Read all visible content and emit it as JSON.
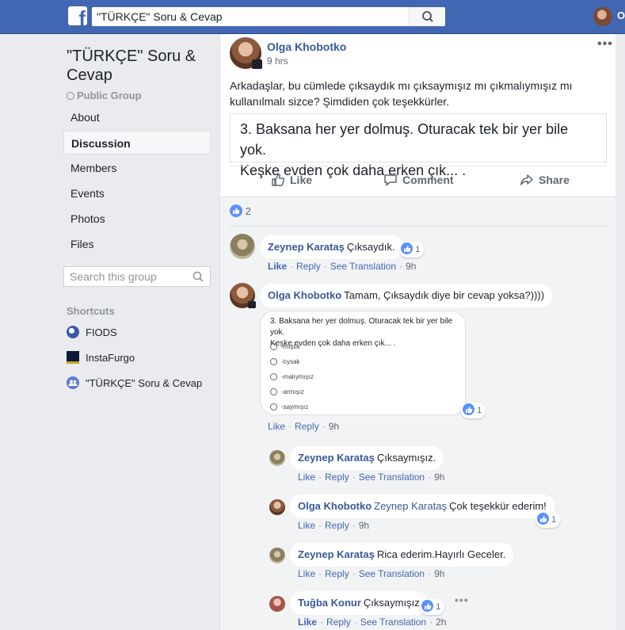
{
  "topbar": {
    "logo": "f",
    "search_value": "\"TÜRKÇE\" Soru & Cevap",
    "user_initial": "O"
  },
  "sidebar": {
    "group_title": "\"TÜRKÇE\" Soru & Cevap",
    "group_type": "Public Group",
    "nav": [
      "About",
      "Discussion",
      "Members",
      "Events",
      "Photos",
      "Files"
    ],
    "active_nav": "Discussion",
    "search_placeholder": "Search this group",
    "shortcuts_heading": "Shortcuts",
    "shortcuts": [
      "FIODS",
      "InstaFurgo",
      "\"TÜRKÇE\" Soru & Cevap"
    ]
  },
  "post": {
    "author": "Olga Khobotko",
    "time": "9 hrs",
    "more": "•••",
    "text": "Arkadaşlar, bu cümlede çıksaydık mı çıksaymışız mı çıkmalıymışız mı kullanılmalı sizce? Şimdiden çok teşekkürler.",
    "image_text_line1": "3. Baksana her yer dolmuş. Oturacak tek bir yer bile yok.",
    "image_text_line2": "Keşke evden çok daha erken çık... .",
    "actions": {
      "like": "Like",
      "comment": "Comment",
      "share": "Share"
    },
    "reaction_count": "2"
  },
  "comments": [
    {
      "author": "Zeynep Karataş",
      "text": "Çıksaydık.",
      "reactions": "1",
      "meta": {
        "like": "Like",
        "reply": "Reply",
        "translate": "See Translation",
        "time": "9h"
      }
    },
    {
      "author": "Olga Khobotko",
      "text": "Tamam, Çıksaydık diye bir cevap yoksa?))))",
      "reactions": "1",
      "image": {
        "question_line1": "3. Baksana her yer dolmuş. Oturacak tek bir yer bile yok.",
        "question_line2": "Keşke evden çok daha erken çık... .",
        "options": [
          "-mıştık",
          "-tıysak",
          "-malıymışız",
          "-armışız",
          "-saymışız"
        ]
      },
      "meta": {
        "like": "Like",
        "reply": "Reply",
        "time": "9h"
      }
    }
  ],
  "replies": [
    {
      "author": "Zeynep Karataş",
      "text": "Çıksaymışız.",
      "meta": {
        "like": "Like",
        "reply": "Reply",
        "translate": "See Translation",
        "time": "9h"
      }
    },
    {
      "author": "Olga Khobotko",
      "mention": "Zeynep Karataş",
      "text": "Çok teşekkür ederim!",
      "reactions": "1",
      "meta": {
        "like": "Like",
        "reply": "Reply",
        "time": "9h"
      }
    },
    {
      "author": "Zeynep Karataş",
      "text": "Rica ederim.Hayırlı Geceler.",
      "meta": {
        "like": "Like",
        "reply": "Reply",
        "translate": "See Translation",
        "time": "9h"
      }
    },
    {
      "author": "Tuğba Konur",
      "text": "Çıksaymışız",
      "reactions": "1",
      "more": "•••",
      "meta": {
        "like": "Like",
        "reply": "Reply",
        "translate": "See Translation",
        "time": "2h"
      }
    }
  ],
  "colors": {
    "topbar": "#4267b2",
    "link": "#385898",
    "page_bg": "#e9ebee",
    "like_blue": "#5890ff"
  }
}
